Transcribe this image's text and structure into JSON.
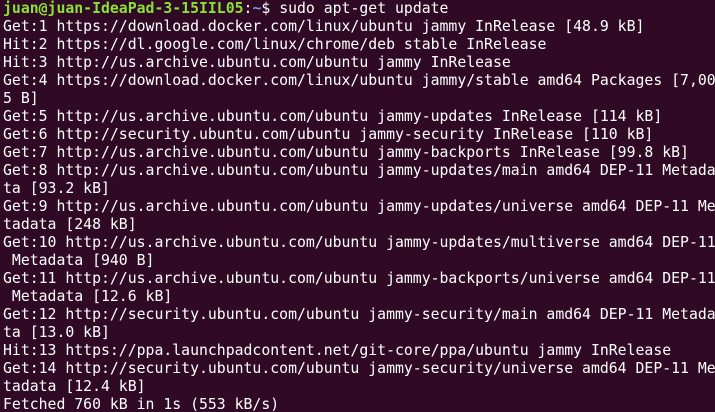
{
  "prompt": {
    "user_host": "juan@juan-IdeaPad-3-15IIL05",
    "colon": ":",
    "path": "~",
    "symbol": "$ ",
    "command": "sudo apt-get update"
  },
  "output_lines": [
    "Get:1 https://download.docker.com/linux/ubuntu jammy InRelease [48.9 kB]",
    "Hit:2 https://dl.google.com/linux/chrome/deb stable InRelease",
    "Hit:3 http://us.archive.ubuntu.com/ubuntu jammy InRelease",
    "Get:4 https://download.docker.com/linux/ubuntu jammy/stable amd64 Packages [7,00",
    "5 B]",
    "Get:5 http://us.archive.ubuntu.com/ubuntu jammy-updates InRelease [114 kB]",
    "Get:6 http://security.ubuntu.com/ubuntu jammy-security InRelease [110 kB]",
    "Get:7 http://us.archive.ubuntu.com/ubuntu jammy-backports InRelease [99.8 kB]",
    "Get:8 http://us.archive.ubuntu.com/ubuntu jammy-updates/main amd64 DEP-11 Metada",
    "ta [93.2 kB]",
    "Get:9 http://us.archive.ubuntu.com/ubuntu jammy-updates/universe amd64 DEP-11 Me",
    "tadata [248 kB]",
    "Get:10 http://us.archive.ubuntu.com/ubuntu jammy-updates/multiverse amd64 DEP-11",
    " Metadata [940 B]",
    "Get:11 http://us.archive.ubuntu.com/ubuntu jammy-backports/universe amd64 DEP-11",
    " Metadata [12.6 kB]",
    "Get:12 http://security.ubuntu.com/ubuntu jammy-security/main amd64 DEP-11 Metada",
    "ta [13.0 kB]",
    "Hit:13 https://ppa.launchpadcontent.net/git-core/ppa/ubuntu jammy InRelease",
    "Get:14 http://security.ubuntu.com/ubuntu jammy-security/universe amd64 DEP-11 Me",
    "tadata [12.4 kB]",
    "Fetched 760 kB in 1s (553 kB/s)"
  ]
}
